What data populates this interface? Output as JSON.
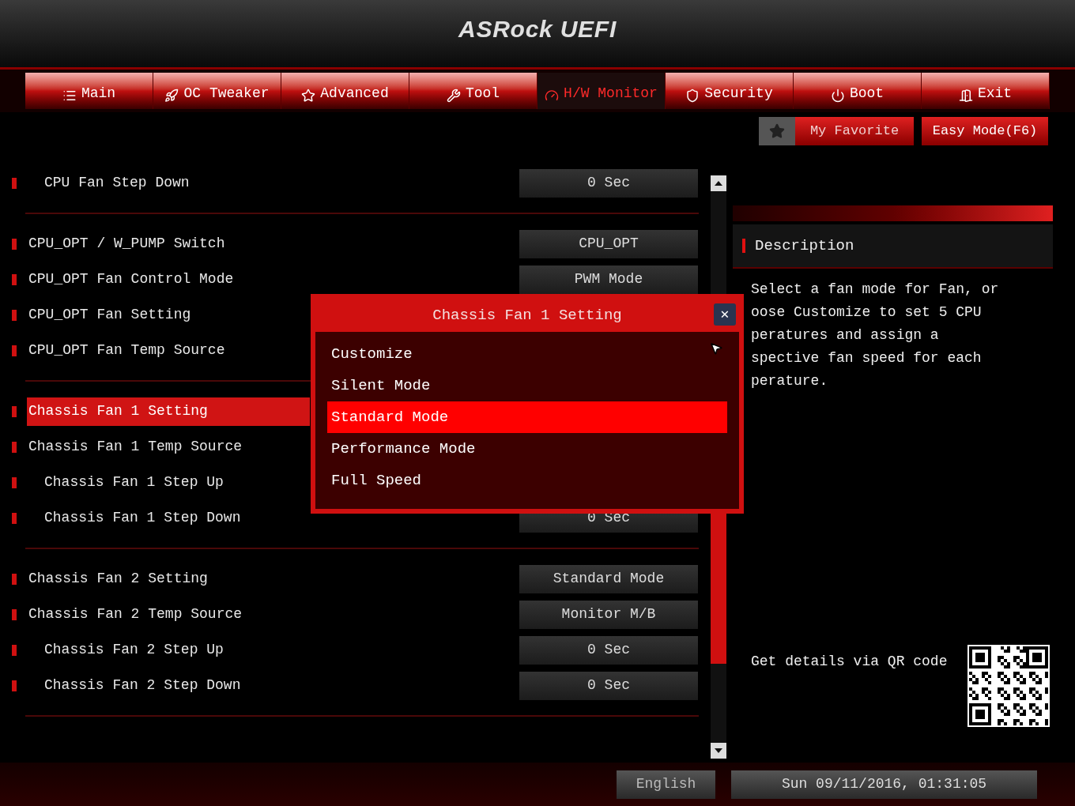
{
  "header": {
    "logo": "ASRock UEFI"
  },
  "tabs": [
    {
      "label": "Main",
      "selected": false
    },
    {
      "label": "OC Tweaker",
      "selected": false
    },
    {
      "label": "Advanced",
      "selected": false
    },
    {
      "label": "Tool",
      "selected": false
    },
    {
      "label": "H/W Monitor",
      "selected": true
    },
    {
      "label": "Security",
      "selected": false
    },
    {
      "label": "Boot",
      "selected": false
    },
    {
      "label": "Exit",
      "selected": false
    }
  ],
  "favorite_bar": {
    "my_favorite": "My Favorite",
    "easy_mode": "Easy Mode(F6)"
  },
  "settings": [
    {
      "rows": [
        {
          "kind": "subitem",
          "label": "CPU Fan Step Down",
          "value": "0 Sec",
          "selected": false
        }
      ]
    },
    {
      "rows": [
        {
          "kind": "item",
          "label": "CPU_OPT / W_PUMP Switch",
          "value": "CPU_OPT",
          "selected": false
        },
        {
          "kind": "item",
          "label": "CPU_OPT Fan Control Mode",
          "value": "PWM Mode",
          "selected": false
        },
        {
          "kind": "item",
          "label": "CPU_OPT Fan Setting",
          "selected": false
        },
        {
          "kind": "item",
          "label": "CPU_OPT Fan Temp Source",
          "selected": false
        }
      ]
    },
    {
      "rows": [
        {
          "kind": "item",
          "label": "Chassis Fan 1 Setting",
          "selected": true
        },
        {
          "kind": "item",
          "label": "Chassis Fan 1 Temp Source",
          "selected": false
        },
        {
          "kind": "subitem",
          "label": "Chassis Fan 1 Step Up",
          "selected": false
        },
        {
          "kind": "subitem",
          "label": "Chassis Fan 1 Step Down",
          "value": "0 Sec",
          "selected": false
        }
      ]
    },
    {
      "rows": [
        {
          "kind": "item",
          "label": "Chassis Fan 2 Setting",
          "value": "Standard Mode",
          "selected": false
        },
        {
          "kind": "item",
          "label": "Chassis Fan 2 Temp Source",
          "value": "Monitor M/B",
          "selected": false
        },
        {
          "kind": "subitem",
          "label": "Chassis Fan 2 Step Up",
          "value": "0 Sec",
          "selected": false
        },
        {
          "kind": "subitem",
          "label": "Chassis Fan 2 Step Down",
          "value": "0 Sec",
          "selected": false
        }
      ]
    }
  ],
  "popup": {
    "title": "Chassis Fan 1 Setting",
    "close": "✕",
    "options": [
      {
        "label": "Customize",
        "selected": false
      },
      {
        "label": "Silent Mode",
        "selected": false
      },
      {
        "label": "Standard Mode",
        "selected": true
      },
      {
        "label": "Performance Mode",
        "selected": false
      },
      {
        "label": "Full Speed",
        "selected": false
      }
    ]
  },
  "description": {
    "title": "Description",
    "lines": [
      "Select a fan mode for Fan, or",
      "oose Customize to set 5 CPU",
      "peratures and assign a",
      "spective fan speed for each",
      "perature."
    ],
    "qr_label": "Get details via QR code"
  },
  "status_bar": {
    "language": "English",
    "datetime": "Sun 09/11/2016, 01:31:05"
  }
}
